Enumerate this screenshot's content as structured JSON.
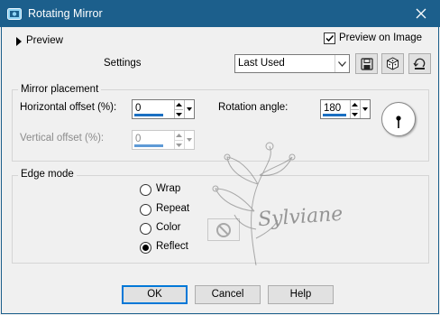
{
  "window": {
    "title": "Rotating Mirror",
    "close_icon": "close-icon",
    "app_icon": "app-icon"
  },
  "header": {
    "preview_label": "Preview",
    "preview_on_image_label": "Preview on Image",
    "preview_on_image_checked": true,
    "settings_label": "Settings",
    "settings_value": "Last Used",
    "tool_icons": [
      "save-preset-icon",
      "randomize-dice-icon",
      "reset-icon"
    ]
  },
  "mirror_placement": {
    "title": "Mirror placement",
    "horizontal_offset_label": "Horizontal offset (%):",
    "horizontal_offset_value": "0",
    "vertical_offset_label": "Vertical offset (%):",
    "vertical_offset_value": "0",
    "rotation_angle_label": "Rotation angle:",
    "rotation_angle_value": "180"
  },
  "edge_mode": {
    "title": "Edge mode",
    "options": [
      "Wrap",
      "Repeat",
      "Color",
      "Reflect"
    ],
    "selected": "Reflect"
  },
  "watermark": {
    "text": "Sylviane"
  },
  "buttons": {
    "ok": "OK",
    "cancel": "Cancel",
    "help": "Help"
  },
  "colors": {
    "titlebar": "#1c5f8c",
    "accent": "#0078d7",
    "face": "#f0f0f0"
  }
}
